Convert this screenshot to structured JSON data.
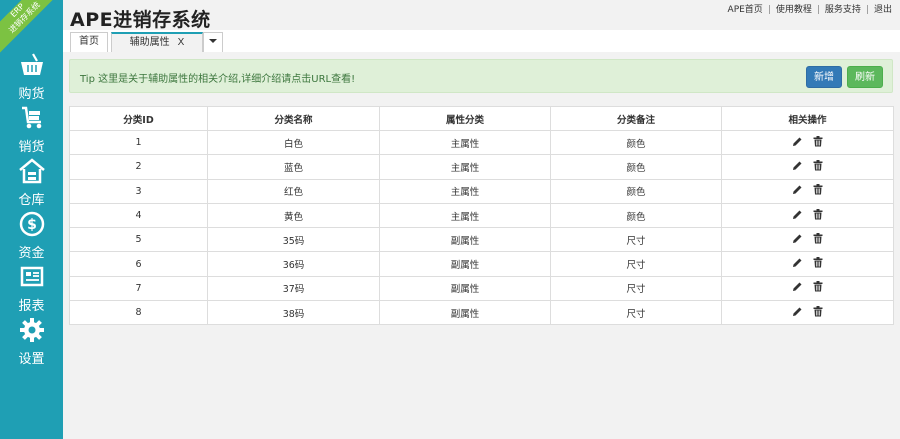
{
  "ribbon": [
    "ERP",
    "进销存系统"
  ],
  "sidebar": {
    "items": [
      {
        "label": "购货",
        "icon": "basket-icon"
      },
      {
        "label": "销货",
        "icon": "cart-icon"
      },
      {
        "label": "仓库",
        "icon": "warehouse-icon"
      },
      {
        "label": "资金",
        "icon": "dollar-icon"
      },
      {
        "label": "报表",
        "icon": "report-icon"
      },
      {
        "label": "设置",
        "icon": "gear-icon"
      }
    ]
  },
  "header": {
    "title": "APE进销存系统",
    "links": [
      "APE首页",
      "使用教程",
      "服务支持",
      "退出"
    ]
  },
  "tabs": [
    {
      "label": "首页"
    },
    {
      "label": "辅助属性",
      "close": "X"
    }
  ],
  "tip": {
    "text": "Tip 这里是关于辅助属性的相关介绍,详细介绍请点击URL查看!",
    "add_label": "新增",
    "refresh_label": "刷新"
  },
  "table": {
    "columns": [
      "分类ID",
      "分类名称",
      "属性分类",
      "分类备注",
      "相关操作"
    ],
    "rows": [
      [
        "1",
        "白色",
        "主属性",
        "颜色"
      ],
      [
        "2",
        "蓝色",
        "主属性",
        "颜色"
      ],
      [
        "3",
        "红色",
        "主属性",
        "颜色"
      ],
      [
        "4",
        "黄色",
        "主属性",
        "颜色"
      ],
      [
        "5",
        "35码",
        "副属性",
        "尺寸"
      ],
      [
        "6",
        "36码",
        "副属性",
        "尺寸"
      ],
      [
        "7",
        "37码",
        "副属性",
        "尺寸"
      ],
      [
        "8",
        "38码",
        "副属性",
        "尺寸"
      ]
    ],
    "row_actions": [
      "edit-icon",
      "trash-icon"
    ]
  },
  "colors": {
    "sidebar": "#1f9fb4",
    "ribbon": "#7cc242",
    "tip_bg": "#dff0d8",
    "tip_text": "#3c763d",
    "primary_button": "#337ab7",
    "success_button": "#5cb85c"
  }
}
